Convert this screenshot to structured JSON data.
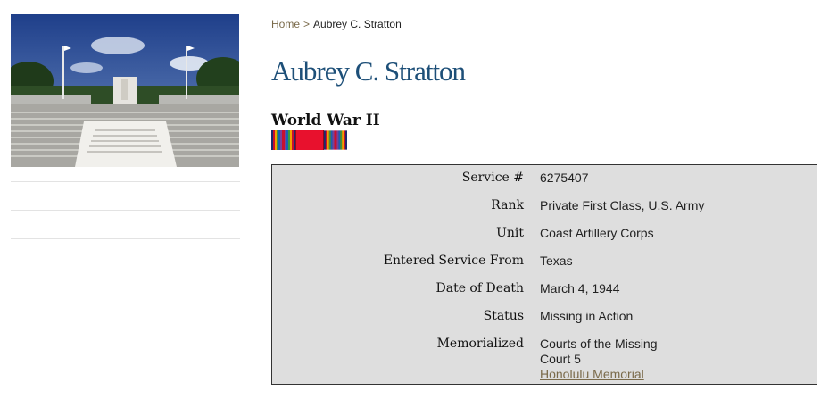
{
  "breadcrumb": {
    "home": "Home",
    "separator": ">",
    "current": "Aubrey C. Stratton"
  },
  "person": {
    "name": "Aubrey C. Stratton"
  },
  "conflict": {
    "name": "World War II"
  },
  "ribbons": [
    "ww2-victory-ribbon",
    "red-service-ribbon",
    "ww2-victory-ribbon"
  ],
  "details": {
    "service_number": {
      "label": "Service #",
      "value": "6275407"
    },
    "rank": {
      "label": "Rank",
      "value": "Private First Class, U.S. Army"
    },
    "unit": {
      "label": "Unit",
      "value": "Coast Artillery Corps"
    },
    "entered_service": {
      "label": "Entered Service From",
      "value": "Texas"
    },
    "date_of_death": {
      "label": "Date of Death",
      "value": "March 4, 1944"
    },
    "status": {
      "label": "Status",
      "value": "Missing in Action"
    },
    "memorialized": {
      "label": "Memorialized",
      "line1": "Courts of the Missing",
      "line2": "Court 5",
      "link": "Honolulu Memorial"
    }
  },
  "colors": {
    "title": "#1d4f78",
    "link": "#7a6a4a",
    "box_bg": "#dedede"
  }
}
